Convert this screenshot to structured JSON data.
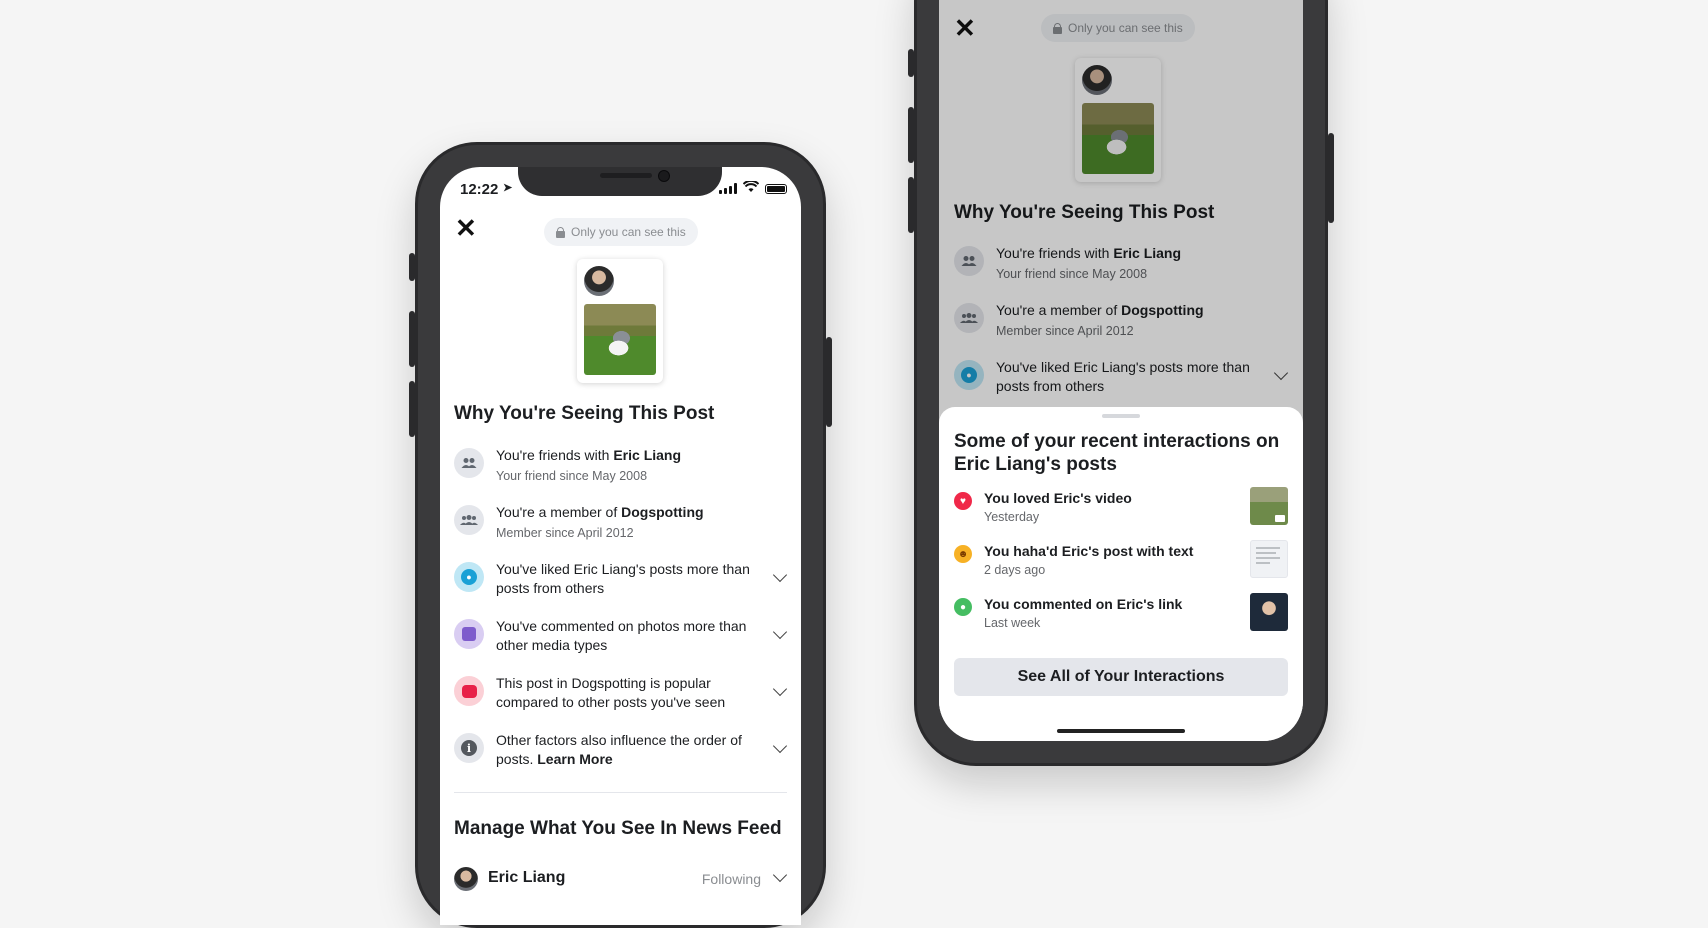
{
  "left_phone": {
    "status": {
      "time": "12:22"
    },
    "privacy_label": "Only you can see this",
    "section_title": "Why You're Seeing This Post",
    "reasons": [
      {
        "pre": "You're friends with ",
        "bold": "Eric Liang",
        "post": "",
        "sub": "Your friend since May 2008",
        "icon": "friends-icon",
        "expandable": false
      },
      {
        "pre": "You're a member of ",
        "bold": "Dogspotting",
        "post": "",
        "sub": "Member since April 2012",
        "icon": "group-icon",
        "expandable": false
      },
      {
        "pre": "You've liked Eric Liang's posts more than posts from others",
        "bold": "",
        "post": "",
        "sub": "",
        "icon": "person-icon",
        "expandable": true
      },
      {
        "pre": "You've commented on photos more than other media types",
        "bold": "",
        "post": "",
        "sub": "",
        "icon": "photo-icon",
        "expandable": true
      },
      {
        "pre": "This post in Dogspotting is popular compared to other posts you've seen",
        "bold": "",
        "post": "",
        "sub": "",
        "icon": "comment-icon",
        "expandable": true
      },
      {
        "pre": "Other factors also influence the order of posts. ",
        "bold": "Learn More",
        "post": "",
        "sub": "",
        "icon": "info-icon",
        "expandable": true
      }
    ],
    "manage_title": "Manage What You See In News Feed",
    "follow_row": {
      "name": "Eric Liang",
      "status": "Following"
    }
  },
  "right_phone": {
    "privacy_label": "Only you can see this",
    "section_title": "Why You're Seeing This Post",
    "reasons": [
      {
        "pre": "You're friends with ",
        "bold": "Eric Liang",
        "sub": "Your friend since May 2008"
      },
      {
        "pre": "You're a member of ",
        "bold": "Dogspotting",
        "sub": "Member since April 2012"
      },
      {
        "pre": "You've liked Eric Liang's posts more than posts from others",
        "bold": "",
        "sub": ""
      }
    ],
    "sheet": {
      "title": "Some of your recent interactions on Eric Liang's posts",
      "interactions": [
        {
          "title": "You loved Eric's video",
          "time": "Yesterday",
          "reaction": "love-icon"
        },
        {
          "title": "You haha'd Eric's post with text",
          "time": "2 days ago",
          "reaction": "haha-icon"
        },
        {
          "title": "You commented on Eric's link",
          "time": "Last week",
          "reaction": "comment-bubble-icon"
        }
      ],
      "see_all_label": "See All of Your Interactions"
    }
  },
  "colors": {
    "love": "#f02849",
    "haha": "#f7b125",
    "comment": "#45bd62",
    "accent_gray": "#e4e6eb"
  }
}
